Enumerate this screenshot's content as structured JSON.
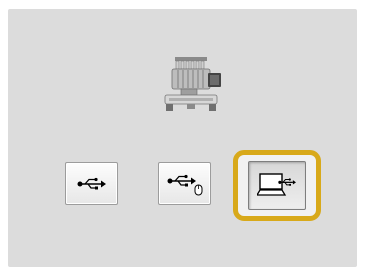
{
  "screen": {
    "title": "",
    "machine_icon": "embroidery-machine-icon"
  },
  "buttons": [
    {
      "icon": "usb-icon",
      "state": "normal"
    },
    {
      "icon": "usb-mouse-icon",
      "state": "normal"
    },
    {
      "icon": "computer-usb-icon",
      "state": "selected"
    }
  ],
  "colors": {
    "panel": "#dcdcdc",
    "selection_frame": "#d8a91a"
  }
}
